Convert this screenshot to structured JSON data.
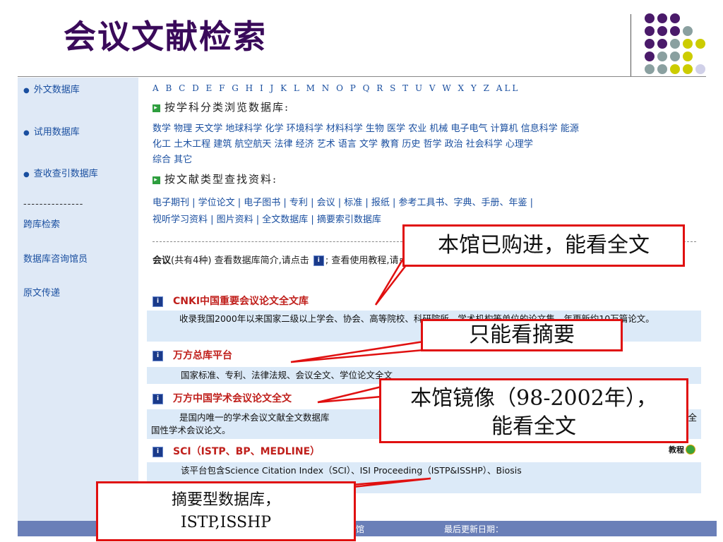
{
  "slide_title": "会议文献检索",
  "colors": {
    "accent_dark": "#4a1a6a",
    "accent_gray": "#8aa0a0",
    "accent_yellow": "#cccc00",
    "accent_light": "#d0d0e8",
    "callout_border": "#e01010"
  },
  "sidebar": {
    "items": [
      {
        "label": "外文数据库",
        "bullet": "●"
      },
      {
        "label": "试用数据库",
        "bullet": "●"
      },
      {
        "label": "查收查引数据库",
        "bullet": "●"
      }
    ],
    "divider": "---------------",
    "links": [
      "跨库检索",
      "数据库咨询馆员",
      "原文传递"
    ]
  },
  "main": {
    "letters": "A B C D E F G H I J K L M N O P Q R S T U V W X Y Z ALL",
    "subject_heading": "按学科分类浏览数据库:",
    "subjects_line1": "数学 物理 天文学 地球科学 化学 环境科学 材料科学 生物 医学 农业 机械 电子电气 计算机 信息科学 能源",
    "subjects_line2": "化工 土木工程 建筑 航空航天 法律 经济 艺术 语言 文学 教育 历史 哲学 政治 社会科学 心理学",
    "subjects_line3": "综合 其它",
    "type_heading": "按文献类型查找资料:",
    "types_line1": "电子期刊 | 学位论文 | 电子图书 | 专利 | 会议 | 标准 | 报纸 | 参考工具书、字典、手册、年鉴 |",
    "types_line2": "视听学习资料 | 图片资料 | 全文数据库 | 摘要索引数据库",
    "intro_bold": "会议",
    "intro_rest": "(共有4种) 查看数据库简介,请点击",
    "intro_mid": "; 查看使用教程,请点击",
    "intro_end": "。",
    "tutorial_label": "教程",
    "db1_title": "CNKI中国重要会议论文全文库",
    "db1_desc": "收录我国2000年以来国家二级以上学会、协会、高等院校、科研院所、学术机构等单位的论文集，年更新约10万篇论文。",
    "db2_title": "万方总库平台",
    "db2_desc": "国家标准、专利、法律法规、会议全文、学位论文全文",
    "db3_title": "万方中国学术会议论文全文",
    "db3_desc_a": "是国内唯一的学术会议文献全文数据库",
    "db3_desc_b": "全",
    "db3_desc_c": "国性学术会议论文。",
    "db4_title": "SCI（ISTP、BP、MEDLINE）",
    "db4_desc": "该平台包含Science Citation Index（SCI）、ISI Proceeding（ISTP&ISSHP）、Biosis"
  },
  "footer": {
    "library": "图书馆",
    "updated": "最后更新日期："
  },
  "callouts": {
    "c1": "本馆已购进，能看全文",
    "c2": "只能看摘要",
    "c3_line1": "本馆镜像（98-2002年），",
    "c3_line2": "能看全文",
    "c4_line1": "摘要型数据库，",
    "c4_line2": "ISTP,ISSHP"
  }
}
